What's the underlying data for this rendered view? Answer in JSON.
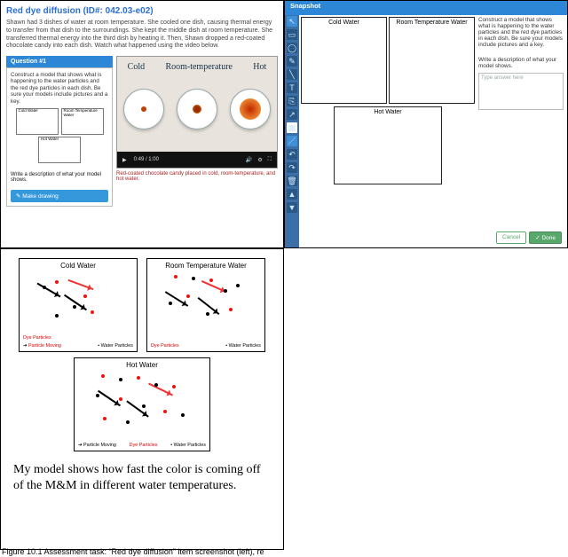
{
  "topLeft": {
    "title": "Red dye diffusion (ID#: 042.03-e02)",
    "description": "Shawn had 3 dishes of water at room temperature. She cooled one dish, causing thermal energy to transfer from that dish to the surroundings. She kept the middle dish at room temperature. She transferred thermal energy into the third dish by heating it. Then, Shawn dropped a red-coated chocolate candy into each dish. Watch what happened using the video below.",
    "question": {
      "header": "Question #1",
      "prompt": "Construct a model that shows what is happening to the water particles and the red dye particles in each dish. Be sure your models include pictures and a key.",
      "boxLabels": {
        "cold": "Cold Water",
        "room": "Room Temperature Water",
        "hot": "Hot Water"
      },
      "descLine": "Write a description of what your model shows.",
      "button": "✎ Make drawing"
    },
    "video": {
      "labels": {
        "cold": "Cold",
        "room": "Room-temperature",
        "hot": "Hot"
      },
      "time": "0:49 / 1:00",
      "caption": "Red-coated chocolate candy placed in cold, room-temperature, and hot water."
    }
  },
  "topRight": {
    "header": "Snapshot",
    "boxLabels": {
      "cold": "Cold Water",
      "room": "Room Temperature Water",
      "hot": "Hot Water"
    },
    "sidePrompt": "Construct a model that shows what is happening to the water particles and the red dye particles in each dish. Be sure your models include pictures and a key.",
    "descLine": "Write a description of what your model shows.",
    "placeholder": "Type answer here",
    "cancel": "Cancel",
    "done": "✓ Done"
  },
  "bottomLeft": {
    "boxLabels": {
      "cold": "Cold Water",
      "room": "Room Temperature Water",
      "hot": "Hot Water"
    },
    "key": {
      "moving": "Particle Moving",
      "dye": "Dye Particles",
      "water": "Water Particles"
    },
    "answer": "My model shows how fast the color is coming off of the M&M in different water temperatures."
  },
  "figure": "Figure 10.1  Assessment task: “Red dye diffusion” item screenshot (left), re"
}
